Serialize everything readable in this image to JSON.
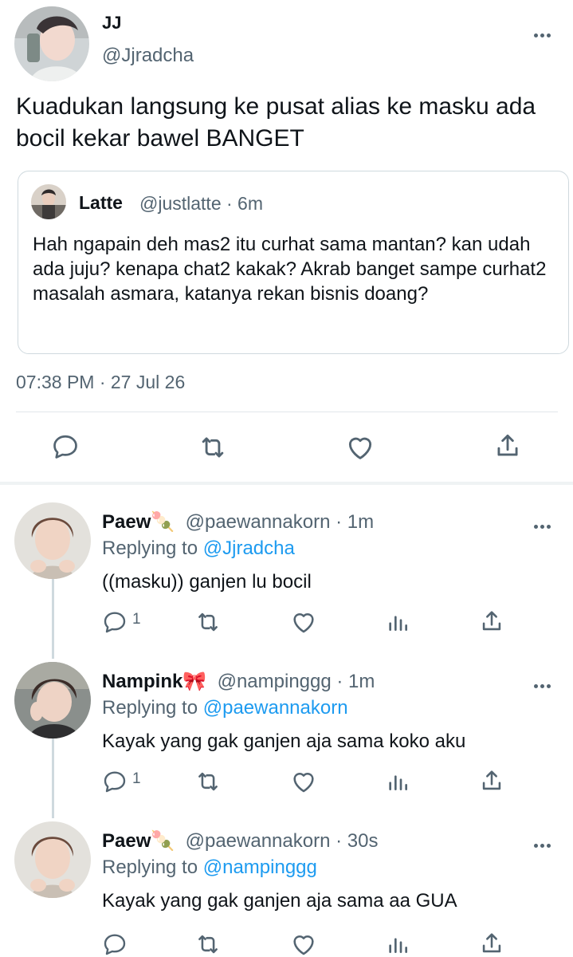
{
  "main_tweet": {
    "name": "JJ",
    "handle": "@Jjradcha",
    "text": "Kuadukan langsung ke pusat alias ke masku ada bocil kekar bawel BANGET",
    "timestamp": "07:38 PM · 27 Jul 26",
    "quote": {
      "name": "Latte",
      "meta": "@justlatte · 6m",
      "text": "Hah ngapain deh mas2 itu curhat sama mantan? kan udah ada juju? kenapa chat2 kakak? Akrab banget sampe curhat2 masalah asmara, katanya rekan bisnis doang?"
    }
  },
  "replies": [
    {
      "name": "Paew",
      "name_emoji": "🍡",
      "meta": "@paewannakorn · 1m",
      "replying_prefix": "Replying to ",
      "replying_to": "@Jjradcha",
      "text": "((masku)) ganjen lu bocil",
      "reply_count": "1"
    },
    {
      "name": "Nampink",
      "name_emoji": "🎀",
      "meta": "@nampinggg · 1m",
      "replying_prefix": "Replying to ",
      "replying_to": "@paewannakorn",
      "text": "Kayak yang gak ganjen aja sama koko aku",
      "reply_count": "1"
    },
    {
      "name": "Paew",
      "name_emoji": "🍡",
      "meta": "@paewannakorn · 30s",
      "replying_prefix": "Replying to ",
      "replying_to": "@nampinggg",
      "text": "Kayak yang gak ganjen aja sama aa GUA",
      "reply_count": ""
    }
  ],
  "icons": {
    "reply": "reply-icon",
    "retweet": "retweet-icon",
    "like": "heart-icon",
    "share": "share-icon",
    "views": "views-icon",
    "more": "more-icon"
  },
  "colors": {
    "text": "#0f1419",
    "secondary": "#536471",
    "link": "#1d9bf0",
    "border": "#cfd9de"
  }
}
